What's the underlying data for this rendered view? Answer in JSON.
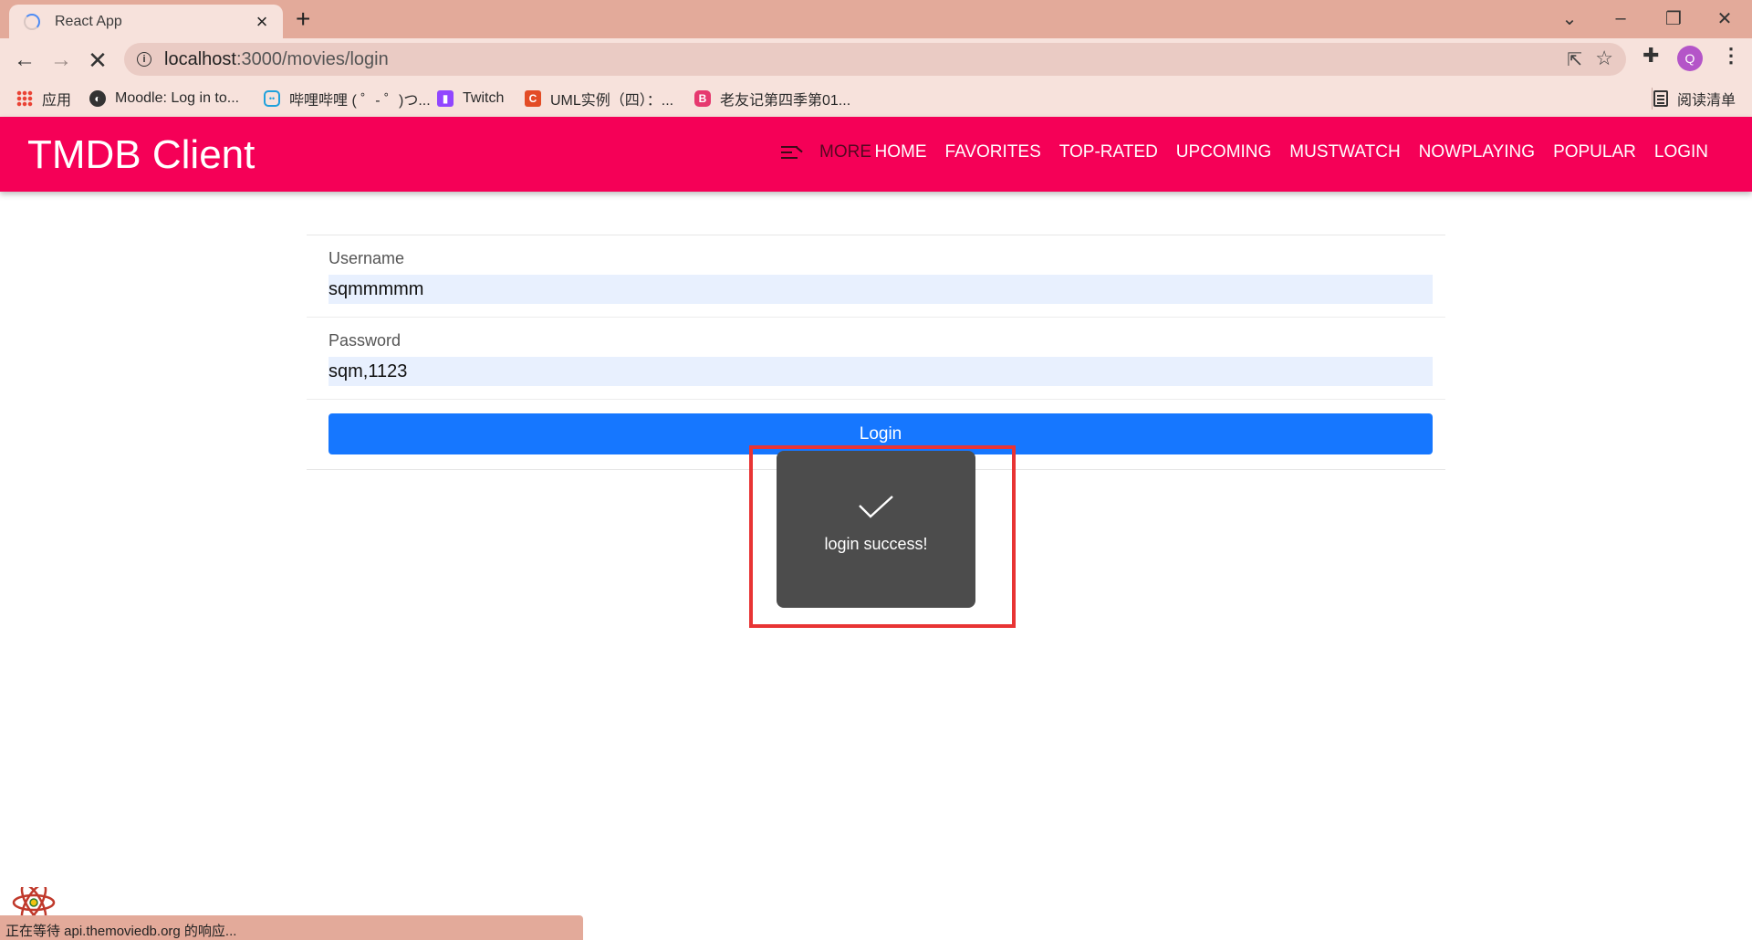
{
  "browser": {
    "tab_title": "React App",
    "url_host": "localhost",
    "url_rest": ":3000/movies/login",
    "bookmarks": [
      "应用",
      "Moodle: Log in to...",
      "哔哩哔哩 ( ゜- ゜)つ...",
      "Twitch",
      "UML实例（四）：...",
      "老友记第四季第01..."
    ],
    "reading_list": "阅读清单",
    "avatar_letter": "Q",
    "status_text": "正在等待 api.themoviedb.org 的响应..."
  },
  "app": {
    "brand": "TMDB Client",
    "more_label": "MORE",
    "nav": [
      "HOME",
      "FAVORITES",
      "TOP-RATED",
      "UPCOMING",
      "MUSTWATCH",
      "NOWPLAYING",
      "POPULAR",
      "LOGIN"
    ]
  },
  "form": {
    "username_label": "Username",
    "username_value": "sqmmmmm",
    "password_label": "Password",
    "password_value": "sqm,1123",
    "login_button": "Login"
  },
  "toast": {
    "message": "login success!"
  },
  "colors": {
    "appbar": "#f50057",
    "primary_button": "#1677ff",
    "toast_bg": "#4c4c4c",
    "highlight": "#e83434"
  }
}
